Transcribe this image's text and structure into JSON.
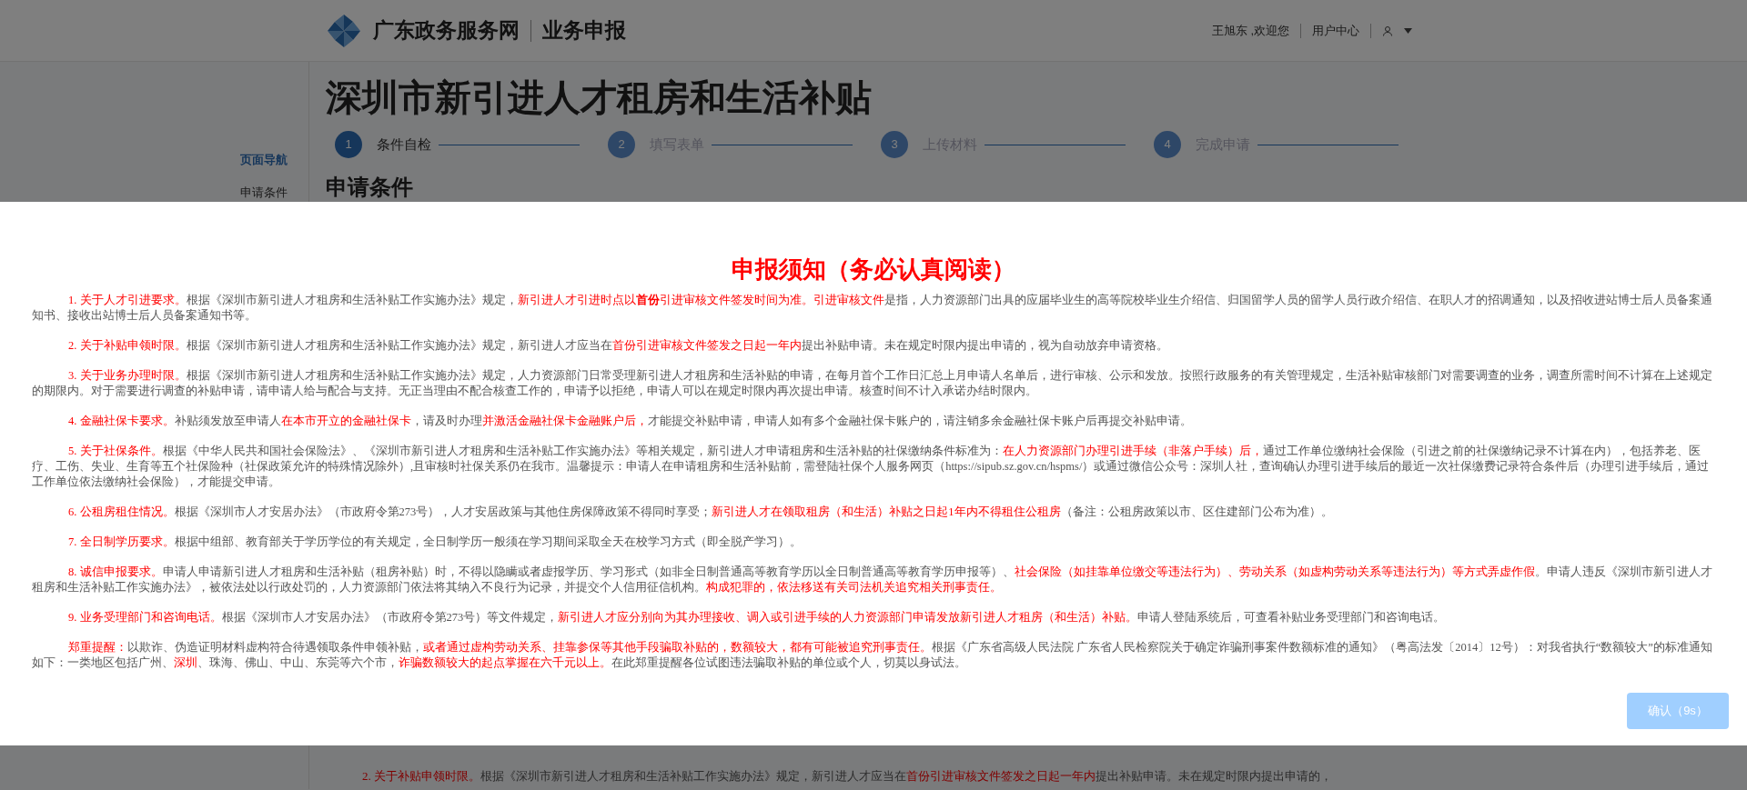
{
  "header": {
    "brand": "广东政务服务网",
    "section": "业务申报",
    "greeting": "王旭东 ,欢迎您",
    "user_center": "用户中心"
  },
  "page_title": "深圳市新引进人才租房和生活补贴",
  "steps": [
    {
      "number": "1",
      "label": "条件自检",
      "selected": true
    },
    {
      "number": "2",
      "label": "填写表单",
      "selected": false
    },
    {
      "number": "3",
      "label": "上传材料",
      "selected": false
    },
    {
      "number": "4",
      "label": "完成申请",
      "selected": false
    }
  ],
  "sidebar": {
    "title": "页面导航",
    "items": [
      "申请条件"
    ]
  },
  "section_heading": "申请条件",
  "background_paragraph": [
    {
      "text": "2. 关于补贴申领时限。",
      "highlight": true
    },
    {
      "text": "根据《深圳市新引进人才租房和生活补贴工作实施办法》规定，新引进人才应当在",
      "highlight": false
    },
    {
      "text": "首份引进审核文件签发之日起一年内",
      "highlight": true
    },
    {
      "text": "提出补贴申请。未在规定时限内提出申请的，",
      "highlight": false
    }
  ],
  "modal": {
    "title": "申报须知（务必认真阅读）",
    "paragraphs": [
      [
        {
          "text": "1. 关于人才引进要求。",
          "highlight": true
        },
        {
          "text": "根据《深圳市新引进人才租房和生活补贴工作实施办法》规定，",
          "highlight": false
        },
        {
          "text": "新引进人才引进时点以**首份**引进审核文件签发时间为准。引进审核文件",
          "highlight": true
        },
        {
          "text": "是指，人力资源部门出具的应届毕业生的高等院校毕业生介绍信、归国留学人员的留学人员行政介绍信、在职人才的招调通知，以及招收进站博士后人员备案通知书、接收出站博士后人员备案通知书等。",
          "highlight": false
        }
      ],
      [
        {
          "text": "2. 关于补贴申领时限。",
          "highlight": true
        },
        {
          "text": "根据《深圳市新引进人才租房和生活补贴工作实施办法》规定，新引进人才应当在",
          "highlight": false
        },
        {
          "text": "首份引进审核文件签发之日起一年内",
          "highlight": true
        },
        {
          "text": "提出补贴申请。未在规定时限内提出申请的，视为自动放弃申请资格。",
          "highlight": false
        }
      ],
      [
        {
          "text": "3. 关于业务办理时限。",
          "highlight": true
        },
        {
          "text": "根据《深圳市新引进人才租房和生活补贴工作实施办法》规定，人力资源部门日常受理新引进人才租房和生活补贴的申请，在每月首个工作日汇总上月申请人名单后，进行审核、公示和发放。按照行政服务的有关管理规定，生活补贴审核部门对需要调查的业务，调查所需时间不计算在上述规定的期限内。对于需要进行调查的补贴申请，请申请人给与配合与支持。无正当理由不配合核查工作的，申请予以拒绝，申请人可以在规定时限内再次提出申请。核查时间不计入承诺办结时限内。",
          "highlight": false
        }
      ],
      [
        {
          "text": "4. 金融社保卡要求。",
          "highlight": true
        },
        {
          "text": "补贴须发放至申请人",
          "highlight": false
        },
        {
          "text": "在本市开立的金融社保卡",
          "highlight": true
        },
        {
          "text": "，请及时办理",
          "highlight": false
        },
        {
          "text": "并激活金融社保卡金融账户后，",
          "highlight": true
        },
        {
          "text": "才能提交补贴申请，申请人如有多个金融社保卡账户的，请注销多余金融社保卡账户后再提交补贴申请。",
          "highlight": false
        }
      ],
      [
        {
          "text": "5. 关于社保条件。",
          "highlight": true
        },
        {
          "text": "根据《中华人民共和国社会保险法》、《深圳市新引进人才租房和生活补贴工作实施办法》等相关规定，新引进人才申请租房和生活补贴的社保缴纳条件标准为：",
          "highlight": false
        },
        {
          "text": "在人力资源部门办理引进手续（非落户手续）后，",
          "highlight": true
        },
        {
          "text": "通过工作单位缴纳社会保险（引进之前的社保缴纳记录不计算在内），包括养老、医疗、工伤、失业、生育等五个社保险种（社保政策允许的特殊情况除外）,且审核时社保关系仍在我市。温馨提示：申请人在申请租房和生活补贴前，需登陆社保个人服务网页（https://sipub.sz.gov.cn/hspms/）或通过微信公众号：深圳人社，查询确认办理引进手续后的最近一次社保缴费记录符合条件后（办理引进手续后，通过工作单位依法缴纳社会保险），才能提交申请。",
          "highlight": false
        }
      ],
      [
        {
          "text": "6. 公租房租住情况。",
          "highlight": true
        },
        {
          "text": "根据《深圳市人才安居办法》（市政府令第273号），人才安居政策与其他住房保障政策不得同时享受；",
          "highlight": false
        },
        {
          "text": "新引进人才在领取租房（和生活）补贴之日起1年内不得租住公租房",
          "highlight": true
        },
        {
          "text": "（备注：公租房政策以市、区住建部门公布为准）。",
          "highlight": false
        }
      ],
      [
        {
          "text": "7. 全日制学历要求。",
          "highlight": true
        },
        {
          "text": "根据中组部、教育部关于学历学位的有关规定，全日制学历一般须在学习期间采取全天在校学习方式（即全脱产学习）。",
          "highlight": false
        }
      ],
      [
        {
          "text": "8. 诚信申报要求。",
          "highlight": true
        },
        {
          "text": "申请人申请新引进人才租房和生活补贴（租房补贴）时，不得以隐瞒或者虚报学历、学习形式（如非全日制普通高等教育学历以全日制普通高等教育学历申报等）、",
          "highlight": false
        },
        {
          "text": "社会保险（如挂靠单位缴交等违法行为）、劳动关系（如虚构劳动关系等违法行为）等方式弄虚作假",
          "highlight": true
        },
        {
          "text": "。申请人违反《深圳市新引进人才租房和生活补贴工作实施办法》，被依法处以行政处罚的，人力资源部门依法将其纳入不良行为记录，并提交个人信用征信机构。",
          "highlight": false
        },
        {
          "text": "构成犯罪的，依法移送有关司法机关追究相关刑事责任。",
          "highlight": true
        }
      ],
      [
        {
          "text": "9. 业务受理部门和咨询电话。",
          "highlight": true
        },
        {
          "text": "根据《深圳市人才安居办法》（市政府令第273号）等文件规定，",
          "highlight": false
        },
        {
          "text": "新引进人才应分别向为其办理接收、调入或引进手续的人力资源部门申请发放新引进人才租房（和生活）补贴。",
          "highlight": true
        },
        {
          "text": "申请人登陆系统后，可查看补贴业务受理部门和咨询电话。",
          "highlight": false
        }
      ],
      [
        {
          "text": "郑重提醒：",
          "highlight": true
        },
        {
          "text": "以欺诈、伪造证明材料虚构符合待遇领取条件申领补贴，",
          "highlight": false
        },
        {
          "text": "或者通过虚构劳动关系、挂靠参保等其他手段骗取补贴的，数额较大，都有可能被追究刑事责任。",
          "highlight": true
        },
        {
          "text": "根据《广东省高级人民法院 广东省人民检察院关于确定诈骗刑事案件数额标准的通知》（粤高法发〔2014〕12号）：对我省执行“数额较大”的标准通知如下：一类地区包括广州、",
          "highlight": false
        },
        {
          "text": "深圳",
          "highlight": true
        },
        {
          "text": "、珠海、佛山、中山、东莞等六个市，",
          "highlight": false
        },
        {
          "text": "诈骗数额较大的起点掌握在六千元以上。",
          "highlight": true
        },
        {
          "text": "在此郑重提醒各位试图违法骗取补贴的单位或个人，切莫以身试法。",
          "highlight": false
        }
      ]
    ],
    "confirm_button": {
      "label": "确认（9s）",
      "disabled": true
    }
  }
}
